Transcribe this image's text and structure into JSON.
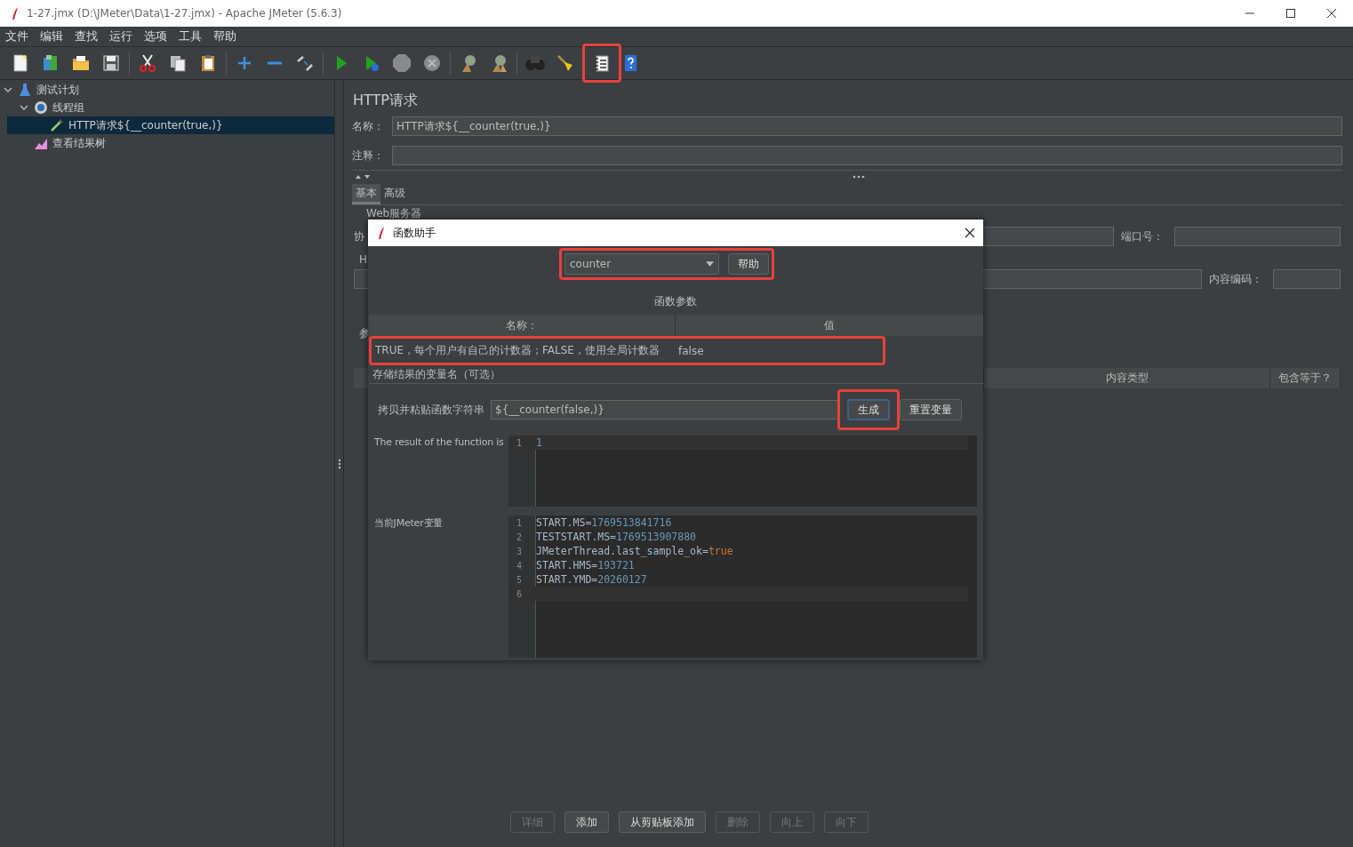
{
  "window": {
    "title": "1-27.jmx (D:\\JMeter\\Data\\1-27.jmx) - Apache JMeter (5.6.3)"
  },
  "menu": [
    "文件",
    "编辑",
    "查找",
    "运行",
    "选项",
    "工具",
    "帮助"
  ],
  "toolbar": [
    [
      {
        "kind": "new",
        "highlighted": false
      },
      {
        "kind": "templates",
        "highlighted": false
      },
      {
        "kind": "open",
        "highlighted": false
      },
      {
        "kind": "save",
        "highlighted": false
      }
    ],
    [
      {
        "kind": "cut",
        "highlighted": false
      },
      {
        "kind": "copy",
        "highlighted": false
      },
      {
        "kind": "paste",
        "highlighted": false
      }
    ],
    [
      {
        "kind": "expand",
        "highlighted": false
      },
      {
        "kind": "collapse",
        "highlighted": false
      },
      {
        "kind": "toggle",
        "highlighted": false
      }
    ],
    [
      {
        "kind": "start",
        "highlighted": false
      },
      {
        "kind": "start-no-timers",
        "highlighted": false
      },
      {
        "kind": "stop",
        "highlighted": false
      },
      {
        "kind": "shutdown",
        "highlighted": false
      }
    ],
    [
      {
        "kind": "clear",
        "highlighted": false
      },
      {
        "kind": "clear-all",
        "highlighted": false
      }
    ],
    [
      {
        "kind": "search",
        "highlighted": false
      },
      {
        "kind": "reset",
        "highlighted": false
      }
    ],
    [
      {
        "kind": "function-helper",
        "highlighted": true
      },
      {
        "kind": "help",
        "highlighted": false
      }
    ]
  ],
  "tree": [
    {
      "label": "测试计划",
      "kind": "plan",
      "expanded": true,
      "selected": false,
      "children": [
        {
          "label": "线程组",
          "kind": "thread-group",
          "expanded": true,
          "selected": false,
          "children": [
            {
              "label": "HTTP请求${__counter(true,)}",
              "kind": "sampler",
              "selected": true
            }
          ]
        },
        {
          "label": "查看结果树",
          "kind": "listener",
          "selected": false
        }
      ]
    }
  ],
  "editor": {
    "title": "HTTP请求",
    "name_label": "名称：",
    "name_value": "HTTP请求${__counter(true,)}",
    "comment_label": "注释：",
    "tabs": [
      {
        "label": "基本",
        "selected": true
      },
      {
        "label": "高级",
        "selected": false
      }
    ],
    "server_group": "Web服务器",
    "protocol_label": "协",
    "port_label": "端口号：",
    "http_group": "H",
    "encoding_label": "内容编码：",
    "params_tab": "参",
    "table_columns": [
      "内容类型",
      "包含等于？"
    ],
    "buttons": [
      {
        "label": "详细",
        "disabled": true
      },
      {
        "label": "添加",
        "disabled": false
      },
      {
        "label": "从剪贴板添加",
        "disabled": false
      },
      {
        "label": "删除",
        "disabled": true
      },
      {
        "label": "向上",
        "disabled": true
      },
      {
        "label": "向下",
        "disabled": true
      }
    ]
  },
  "dialog": {
    "title": "函数助手",
    "function": "counter",
    "help_button": "帮助",
    "selector_highlighted": true,
    "params_title": "函数参数",
    "columns": [
      "名称：",
      "值"
    ],
    "params": [
      {
        "name": "TRUE，每个用户有自己的计数器；FALSE，使用全局计数器",
        "value": "false",
        "highlighted": true
      },
      {
        "name": "存储结果的变量名（可选）",
        "highlighted": false
      }
    ],
    "copy_label": "拷贝并粘贴函数字符串",
    "function_string": "${__counter(false,)}",
    "generate": {
      "label": "生成",
      "highlighted": true
    },
    "reset_button": "重置变量",
    "result_label": "The result of the function is",
    "result_lines": [
      {
        "number": "1",
        "current": true,
        "parts": [
          {
            "text": "1",
            "kind": "number"
          }
        ]
      }
    ],
    "vars_label": "当前JMeter变量",
    "var_lines": [
      {
        "number": "1",
        "current": false,
        "parts": [
          {
            "text": "START.MS=",
            "kind": "plain"
          },
          {
            "text": "1769513841716",
            "kind": "number"
          }
        ]
      },
      {
        "number": "2",
        "current": false,
        "parts": [
          {
            "text": "TESTSTART.MS=",
            "kind": "plain"
          },
          {
            "text": "1769513907880",
            "kind": "number"
          }
        ]
      },
      {
        "number": "3",
        "current": false,
        "parts": [
          {
            "text": "JMeterThread.last_sample_ok=",
            "kind": "plain"
          },
          {
            "text": "true",
            "kind": "boolean"
          }
        ]
      },
      {
        "number": "4",
        "current": false,
        "parts": [
          {
            "text": "START.HMS=",
            "kind": "plain"
          },
          {
            "text": "193721",
            "kind": "number"
          }
        ]
      },
      {
        "number": "5",
        "current": false,
        "parts": [
          {
            "text": "START.YMD=",
            "kind": "plain"
          },
          {
            "text": "20260127",
            "kind": "number"
          }
        ]
      },
      {
        "number": "6",
        "current": true
      }
    ]
  }
}
